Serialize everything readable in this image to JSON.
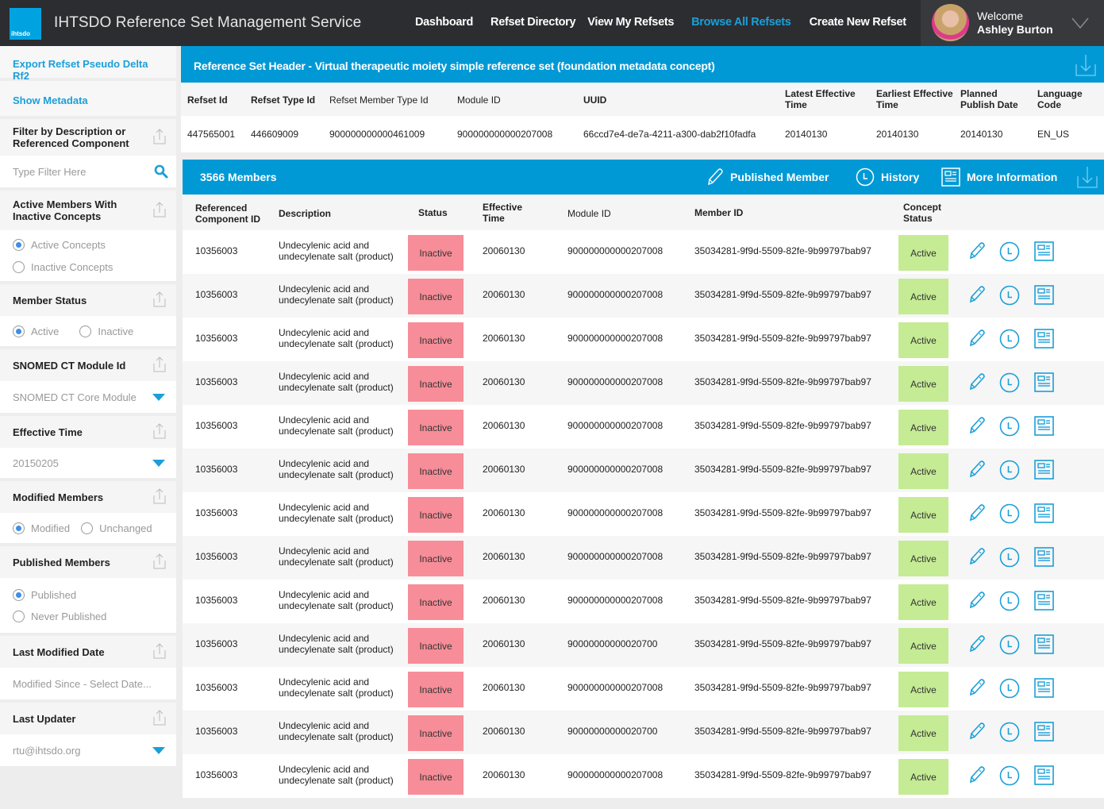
{
  "app": {
    "logo_text": "ihtsdo",
    "title": "IHTSDO Reference Set Management Service"
  },
  "nav": {
    "items": [
      {
        "label": "Dashboard",
        "active": false
      },
      {
        "label": "Refset Directory",
        "active": false
      },
      {
        "label": "View My Refsets",
        "active": false
      },
      {
        "label": "Browse All Refsets",
        "active": true
      },
      {
        "label": "Create New Refset",
        "active": false
      }
    ]
  },
  "user": {
    "greeting": "Welcome",
    "name": "Ashley Burton"
  },
  "sidebar": {
    "export_link": "Export Refset Pseudo Delta Rf2",
    "metadata_link": "Show Metadata",
    "filter": {
      "title": "Filter by Description or Referenced Component",
      "placeholder": "Type Filter Here"
    },
    "active_members": {
      "title": "Active Members With Inactive Concepts",
      "options": [
        "Active Concepts",
        "Inactive Concepts"
      ],
      "selected": "Active Concepts"
    },
    "member_status": {
      "title": "Member Status",
      "options": [
        "Active",
        "Inactive"
      ],
      "selected": "Active"
    },
    "module_id": {
      "title": "SNOMED CT Module Id",
      "value": "SNOMED CT Core Module"
    },
    "effective_time": {
      "title": "Effective Time",
      "value": "20150205"
    },
    "modified_members": {
      "title": "Modified Members",
      "options": [
        "Modified",
        "Unchanged"
      ],
      "selected": "Modified"
    },
    "published_members": {
      "title": "Published Members",
      "options": [
        "Published",
        "Never Published"
      ],
      "selected": "Published"
    },
    "last_modified": {
      "title": "Last Modified Date",
      "placeholder": "Modified Since - Select Date..."
    },
    "last_updater": {
      "title": "Last Updater",
      "value": "rtu@ihtsdo.org"
    }
  },
  "header_panel": {
    "title": "Reference Set Header - Virtual therapeutic moiety simple reference set (foundation metadata concept)",
    "columns": [
      "Refset Id",
      "Refset Type Id",
      "Refset Member Type Id",
      "Module ID",
      "UUID",
      "Latest Effective Time",
      "Earliest Effective Time",
      "Planned Publish Date",
      "Language Code"
    ],
    "values": [
      "447565001",
      "446609009",
      "900000000000461009",
      "900000000000207008",
      "66ccd7e4-de7a-4211-a300-dab2f10fadfa",
      "20140130",
      "20140130",
      "20140130",
      "EN_US"
    ]
  },
  "members_panel": {
    "title": "3566 Members",
    "actions": [
      "Published Member",
      "History",
      "More Information"
    ],
    "columns": [
      "Referenced Component ID",
      "Description",
      "Status",
      "Effective Time",
      "Module ID",
      "Member ID",
      "Concept Status"
    ],
    "rows": [
      {
        "ref": "10356003",
        "desc": "Undecylenic acid and undecylenate salt (product)",
        "status": "Inactive",
        "eff": "20060130",
        "module": "900000000000207008",
        "member": "35034281-9f9d-5509-82fe-9b99797bab97",
        "concept_status": "Active"
      },
      {
        "ref": "10356003",
        "desc": "Undecylenic acid and undecylenate salt (product)",
        "status": "Inactive",
        "eff": "20060130",
        "module": "900000000000207008",
        "member": "35034281-9f9d-5509-82fe-9b99797bab97",
        "concept_status": "Active"
      },
      {
        "ref": "10356003",
        "desc": "Undecylenic acid and undecylenate salt (product)",
        "status": "Inactive",
        "eff": "20060130",
        "module": "900000000000207008",
        "member": "35034281-9f9d-5509-82fe-9b99797bab97",
        "concept_status": "Active"
      },
      {
        "ref": "10356003",
        "desc": "Undecylenic acid and undecylenate salt (product)",
        "status": "Inactive",
        "eff": "20060130",
        "module": "900000000000207008",
        "member": "35034281-9f9d-5509-82fe-9b99797bab97",
        "concept_status": "Active"
      },
      {
        "ref": "10356003",
        "desc": "Undecylenic acid and undecylenate salt (product)",
        "status": "Inactive",
        "eff": "20060130",
        "module": "900000000000207008",
        "member": "35034281-9f9d-5509-82fe-9b99797bab97",
        "concept_status": "Active"
      },
      {
        "ref": "10356003",
        "desc": "Undecylenic acid and undecylenate salt (product)",
        "status": "Inactive",
        "eff": "20060130",
        "module": "900000000000207008",
        "member": "35034281-9f9d-5509-82fe-9b99797bab97",
        "concept_status": "Active"
      },
      {
        "ref": "10356003",
        "desc": "Undecylenic acid and undecylenate salt (product)",
        "status": "Inactive",
        "eff": "20060130",
        "module": "900000000000207008",
        "member": "35034281-9f9d-5509-82fe-9b99797bab97",
        "concept_status": "Active"
      },
      {
        "ref": "10356003",
        "desc": "Undecylenic acid and undecylenate salt (product)",
        "status": "Inactive",
        "eff": "20060130",
        "module": "900000000000207008",
        "member": "35034281-9f9d-5509-82fe-9b99797bab97",
        "concept_status": "Active"
      },
      {
        "ref": "10356003",
        "desc": "Undecylenic acid and undecylenate salt (product)",
        "status": "Inactive",
        "eff": "20060130",
        "module": "900000000000207008",
        "member": "35034281-9f9d-5509-82fe-9b99797bab97",
        "concept_status": "Active"
      },
      {
        "ref": "10356003",
        "desc": "Undecylenic acid and undecylenate salt (product)",
        "status": "Inactive",
        "eff": "20060130",
        "module": "90000000000020700",
        "member": "35034281-9f9d-5509-82fe-9b99797bab97",
        "concept_status": "Active"
      },
      {
        "ref": "10356003",
        "desc": "Undecylenic acid and undecylenate salt (product)",
        "status": "Inactive",
        "eff": "20060130",
        "module": "900000000000207008",
        "member": "35034281-9f9d-5509-82fe-9b99797bab97",
        "concept_status": "Active"
      },
      {
        "ref": "10356003",
        "desc": "Undecylenic acid and undecylenate salt (product)",
        "status": "Inactive",
        "eff": "20060130",
        "module": "90000000000020700",
        "member": "35034281-9f9d-5509-82fe-9b99797bab97",
        "concept_status": "Active"
      },
      {
        "ref": "10356003",
        "desc": "Undecylenic acid and undecylenate salt (product)",
        "status": "Inactive",
        "eff": "20060130",
        "module": "900000000000207008",
        "member": "35034281-9f9d-5509-82fe-9b99797bab97",
        "concept_status": "Active"
      }
    ]
  },
  "colors": {
    "accent": "#0099d6",
    "topbar": "#2c2d30",
    "status_inactive": "#f78d98",
    "status_active": "#c5eb95"
  }
}
